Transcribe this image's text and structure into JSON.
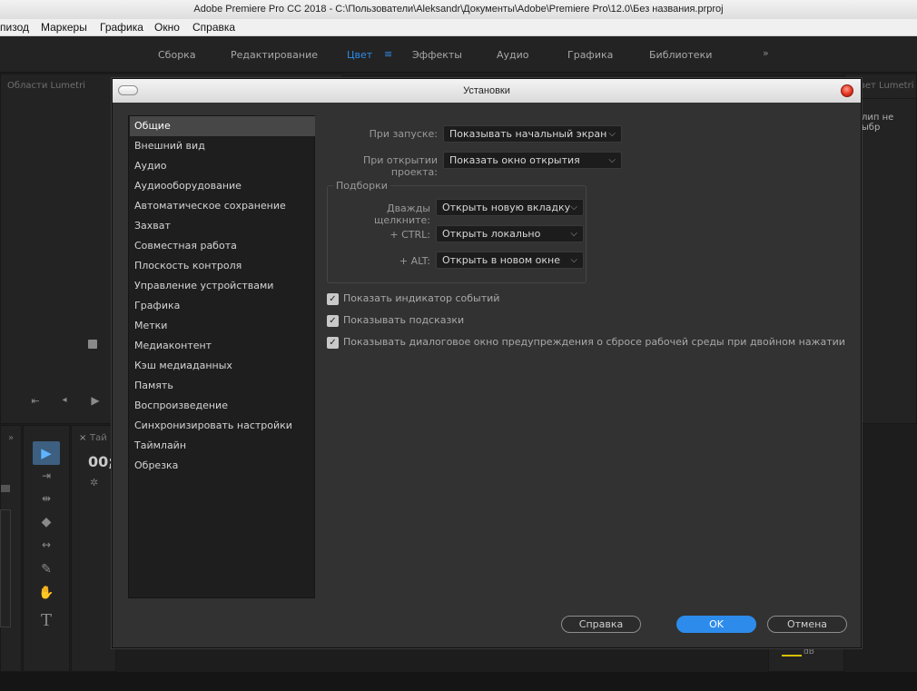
{
  "window": {
    "title": "Adobe Premiere Pro CC 2018 - C:\\Пользователи\\Aleksandr\\Документы\\Adobe\\Premiere Pro\\12.0\\Без названия.prproj"
  },
  "menu": [
    "пизод",
    "Маркеры",
    "Графика",
    "Окно",
    "Справка"
  ],
  "workspaces": {
    "items": [
      "Сборка",
      "Редактирование",
      "Цвет",
      "Эффекты",
      "Аудио",
      "Графика",
      "Библиотеки"
    ],
    "active": "Цвет",
    "more": "»",
    "menu_icon": "≡"
  },
  "panels": {
    "lumetri_scopes": "Области Lumetri",
    "lumetri_color": "вет Lumetri",
    "clip_not_selected": "клип не выбр",
    "timeline_tab": "Тай",
    "timecode": "00;0",
    "panel_more": "»",
    "tab_close": "×",
    "meter_label": "dB"
  },
  "dialog": {
    "title": "Установки",
    "categories": [
      "Общие",
      "Внешний вид",
      "Аудио",
      "Аудиооборудование",
      "Автоматическое сохранение",
      "Захват",
      "Совместная работа",
      "Плоскость контроля",
      "Управление устройствами",
      "Графика",
      "Метки",
      "Медиаконтент",
      "Кэш медиаданных",
      "Память",
      "Воспроизведение",
      "Синхронизировать настройки",
      "Таймлайн",
      "Обрезка"
    ],
    "selected_category": "Общие",
    "startup": {
      "label": "При запуске:",
      "value": "Показывать начальный экран"
    },
    "open_project": {
      "label": "При открытии проекта:",
      "value": "Показать окно открытия"
    },
    "bins": {
      "title": "Подборки",
      "double_click": {
        "label": "Дважды щелкните:",
        "value": "Открыть новую вкладку"
      },
      "ctrl": {
        "label": "+ CTRL:",
        "value": "Открыть локально"
      },
      "alt": {
        "label": "+ ALT:",
        "value": "Открыть в новом окне"
      }
    },
    "checkboxes": [
      {
        "label": "Показать индикатор событий",
        "checked": true
      },
      {
        "label": "Показывать подсказки",
        "checked": true
      },
      {
        "label": "Показывать диалоговое окно предупреждения о сбросе рабочей среды при двойном нажатии",
        "checked": true
      }
    ],
    "buttons": {
      "help": "Справка",
      "ok": "OK",
      "cancel": "Отмена"
    }
  },
  "colors": {
    "accent": "#2d8ceb",
    "dialog_bg": "#323232",
    "list_bg": "#1e1e1e",
    "selected_bg": "#474747"
  }
}
